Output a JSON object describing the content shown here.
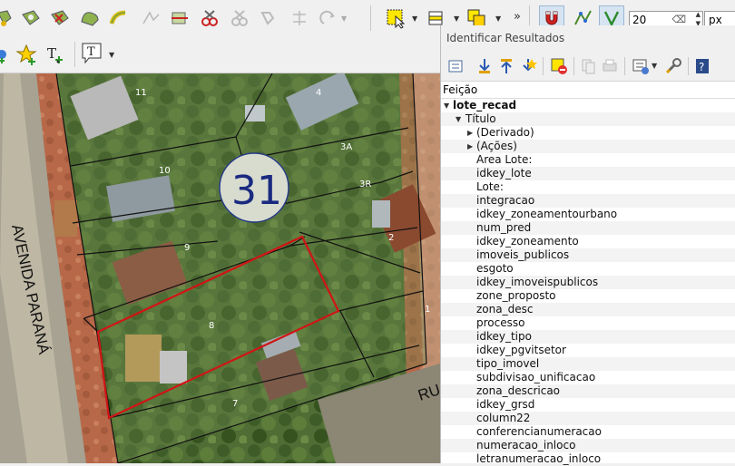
{
  "toolbar": {
    "width_value": "20",
    "width_unit": "px"
  },
  "identify": {
    "title": "Identificar Resultados",
    "column_header": "Feição",
    "layer": "lote_recad",
    "group": "Título",
    "expanders": [
      "(Derivado)",
      "(Ações)"
    ],
    "fields": [
      "Area Lote:",
      "idkey_lote",
      "Lote:",
      "integracao",
      "idkey_zoneamentourbano",
      "num_pred",
      "idkey_zoneamento",
      "imoveis_publicos",
      "esgoto",
      "idkey_imoveispublicos",
      "zone_proposto",
      "zona_desc",
      "processo",
      "idkey_tipo",
      "idkey_pgvitsetor",
      "tipo_imovel",
      "subdivisao_unificacao",
      "zona_descricao",
      "idkey_grsd",
      "column22",
      "conferencianumeracao",
      "numeracao_inloco",
      "letranumeracao_inloco"
    ]
  },
  "map": {
    "street_label": "AVENIDA PARANÁ",
    "street_label_2": "RU",
    "block_number": "31",
    "lot_labels": [
      "11",
      "4",
      "3A",
      "10",
      "3R",
      "2",
      "9",
      "8",
      "1",
      "7"
    ]
  }
}
